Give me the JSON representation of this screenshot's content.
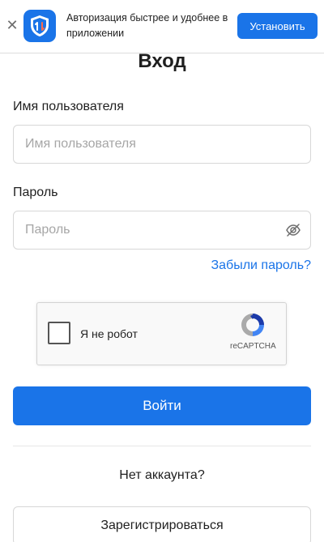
{
  "banner": {
    "text": "Авторизация быстрее и удобнее в приложении",
    "install_label": "Установить",
    "close_icon": "close-icon",
    "logo_icon": "app-shield-logo"
  },
  "login": {
    "title": "Вход",
    "username_label": "Имя пользователя",
    "username_placeholder": "Имя пользователя",
    "password_label": "Пароль",
    "password_placeholder": "Пароль",
    "toggle_password_icon": "eye-off-icon",
    "forgot_label": "Забыли пароль?",
    "submit_label": "Войти"
  },
  "captcha": {
    "label": "Я не робот",
    "brand": "reCAPTCHA",
    "checked": false
  },
  "register": {
    "prompt": "Нет аккаунта?",
    "button_label": "Зарегистрироваться"
  },
  "colors": {
    "accent": "#1a74e8",
    "border": "#d7d7d7"
  }
}
